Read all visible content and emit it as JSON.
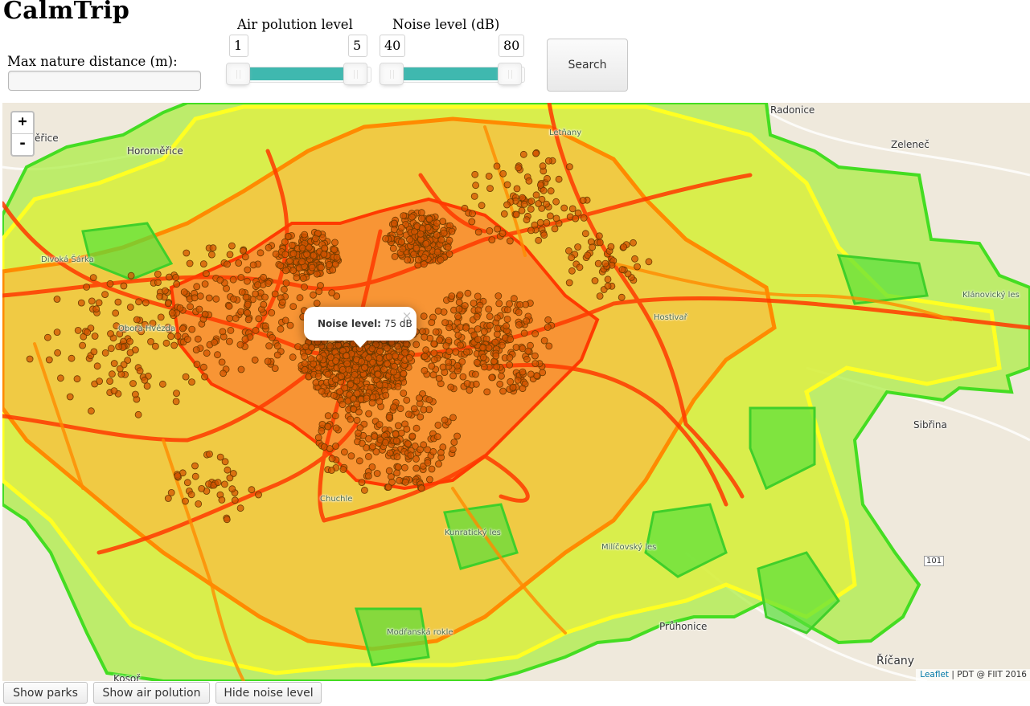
{
  "header": {
    "title": "CalmTrip"
  },
  "controls": {
    "nature_distance": {
      "label": "Max nature distance (m):",
      "value": ""
    },
    "air_pollution": {
      "label": "Air polution level",
      "min": 1,
      "max": 5,
      "min_label": "1",
      "max_label": "5"
    },
    "noise": {
      "label": "Noise level (dB)",
      "min": 40,
      "max": 80,
      "min_label": "40",
      "max_label": "80"
    },
    "search_label": "Search"
  },
  "map": {
    "zoom_in": "+",
    "zoom_out": "-",
    "places": [
      {
        "name": "Radonice",
        "cls": ""
      },
      {
        "name": "Zeleneč",
        "cls": ""
      },
      {
        "name": "Horoměřice",
        "cls": ""
      },
      {
        "name": "ěřice",
        "cls": ""
      },
      {
        "name": "Sibřina",
        "cls": ""
      },
      {
        "name": "Průhonice",
        "cls": ""
      },
      {
        "name": "Říčany",
        "cls": ""
      },
      {
        "name": "Kosoř",
        "cls": ""
      },
      {
        "name": "Divoká Šárka",
        "cls": "small"
      },
      {
        "name": "Obora Hvězda",
        "cls": "small"
      },
      {
        "name": "Kunratický les",
        "cls": "small"
      },
      {
        "name": "Milíčovský les",
        "cls": "small"
      },
      {
        "name": "Modřanská rokle",
        "cls": "small"
      },
      {
        "name": "Klánovický les",
        "cls": "small"
      },
      {
        "name": "Hostivař",
        "cls": "small"
      },
      {
        "name": "Letňany",
        "cls": "small"
      },
      {
        "name": "Chuchle",
        "cls": "small"
      },
      {
        "name": "101",
        "cls": "small"
      }
    ],
    "popup": {
      "label": "Noise level:",
      "value": "75 dB",
      "close": "×"
    },
    "attribution": {
      "link": "Leaflet",
      "text": " | PDT @ FIIT 2016"
    },
    "colors": {
      "quiet": "#33cc33",
      "moderate": "#ffff00",
      "loud": "#ff8800",
      "very_loud": "#ff2200",
      "poi_fill": "#d35400",
      "background": "#efe9dc"
    }
  },
  "layer_buttons": {
    "parks": "Show parks",
    "air": "Show air polution",
    "noise": "Hide noise level"
  }
}
